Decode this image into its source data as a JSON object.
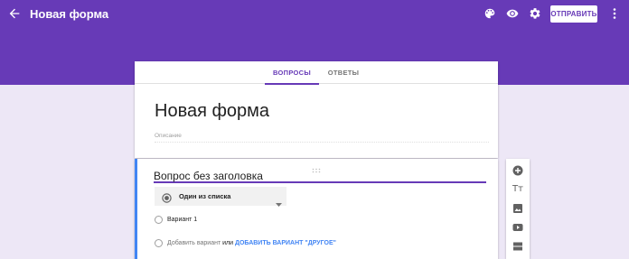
{
  "header": {
    "title": "Новая форма",
    "send_label": "ОТПРАВИТЬ",
    "icons": [
      "back-arrow-icon",
      "palette-icon",
      "eye-icon",
      "gear-icon",
      "more-vert-icon"
    ],
    "background_color": "#673ab7"
  },
  "tabs": [
    {
      "label": "ВОПРОСЫ",
      "active": true
    },
    {
      "label": "ОТВЕТЫ",
      "active": false
    }
  ],
  "form": {
    "title": "Новая форма",
    "description_placeholder": "Описание"
  },
  "question": {
    "title": "Вопрос без заголовка",
    "type": "Один из списка",
    "options": [
      "Вариант 1"
    ],
    "add_option": "Добавить вариант",
    "add_or": "или",
    "add_other": "ДОБАВИТЬ ВАРИАНТ \"ДРУГОЕ\""
  },
  "toolbar": {
    "tools": [
      "add-question-icon",
      "add-title-text-icon",
      "add-image-icon",
      "add-video-icon",
      "add-section-icon"
    ],
    "title_text_glyph": "Тт"
  },
  "colors": {
    "accent": "#673ab7",
    "page_background": "#ede7f6",
    "link": "#4285f4",
    "question_indicator": "#4285f4"
  }
}
